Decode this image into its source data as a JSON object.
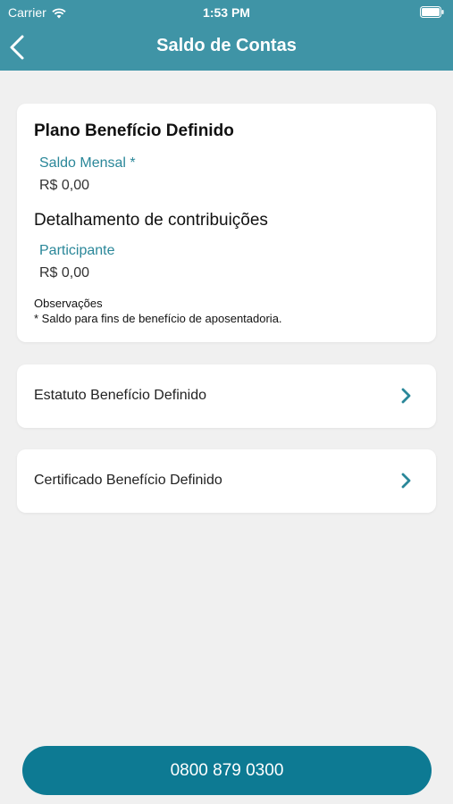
{
  "status_bar": {
    "carrier": "Carrier",
    "time": "1:53 PM"
  },
  "nav": {
    "title": "Saldo de Contas"
  },
  "plan": {
    "title": "Plano Benefício Definido",
    "saldo_label": "Saldo Mensal *",
    "saldo_value": "R$ 0,00",
    "detalhamento_title": "Detalhamento de contribuições",
    "participante_label": "Participante",
    "participante_value": "R$ 0,00",
    "observacoes_label": "Observações",
    "observacoes_text": "* Saldo para fins de benefício de aposentadoria."
  },
  "links": [
    {
      "label": "Estatuto Benefício Definido"
    },
    {
      "label": "Certificado Benefício Definido"
    }
  ],
  "phone_button": {
    "label": "0800 879 0300"
  },
  "colors": {
    "header": "#3f94a6",
    "accent_text": "#2a8799",
    "button": "#0d7a93",
    "background": "#f0f0f0"
  }
}
